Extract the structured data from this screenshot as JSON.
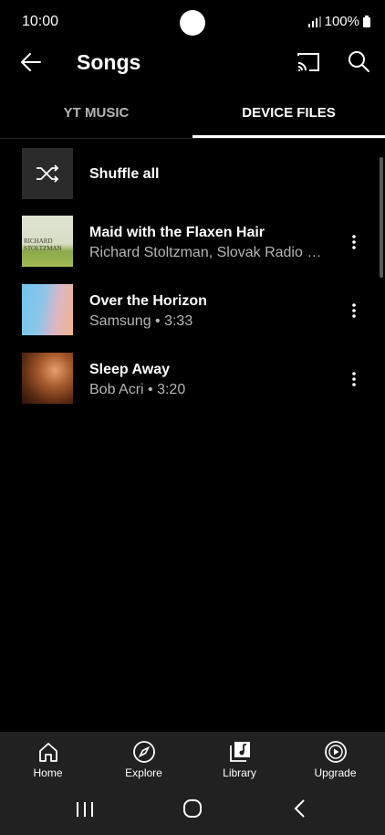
{
  "status": {
    "time": "10:00",
    "battery": "100%"
  },
  "header": {
    "title": "Songs",
    "back_icon": "arrow-back-icon",
    "cast_icon": "cast-icon",
    "search_icon": "search-icon"
  },
  "tabs": [
    {
      "label": "YT MUSIC",
      "selected": false
    },
    {
      "label": "DEVICE FILES",
      "selected": true
    }
  ],
  "shuffle": {
    "label": "Shuffle all",
    "icon": "shuffle-icon"
  },
  "songs": [
    {
      "title": "Maid with the Flaxen Hair",
      "subtitle": "Richard Stoltzman, Slovak Radio S...",
      "art_text": "RICHARD STOLTZMAN"
    },
    {
      "title": "Over the Horizon",
      "subtitle": "Samsung • 3:33"
    },
    {
      "title": "Sleep Away",
      "subtitle": "Bob Acri • 3:20"
    }
  ],
  "bottom_nav": [
    {
      "label": "Home",
      "icon": "home-icon"
    },
    {
      "label": "Explore",
      "icon": "compass-icon"
    },
    {
      "label": "Library",
      "icon": "library-icon",
      "selected": true
    },
    {
      "label": "Upgrade",
      "icon": "play-circle-icon"
    }
  ],
  "colors": {
    "background": "#000000",
    "nav_background": "#212121",
    "secondary_text": "#b5b5b5"
  }
}
